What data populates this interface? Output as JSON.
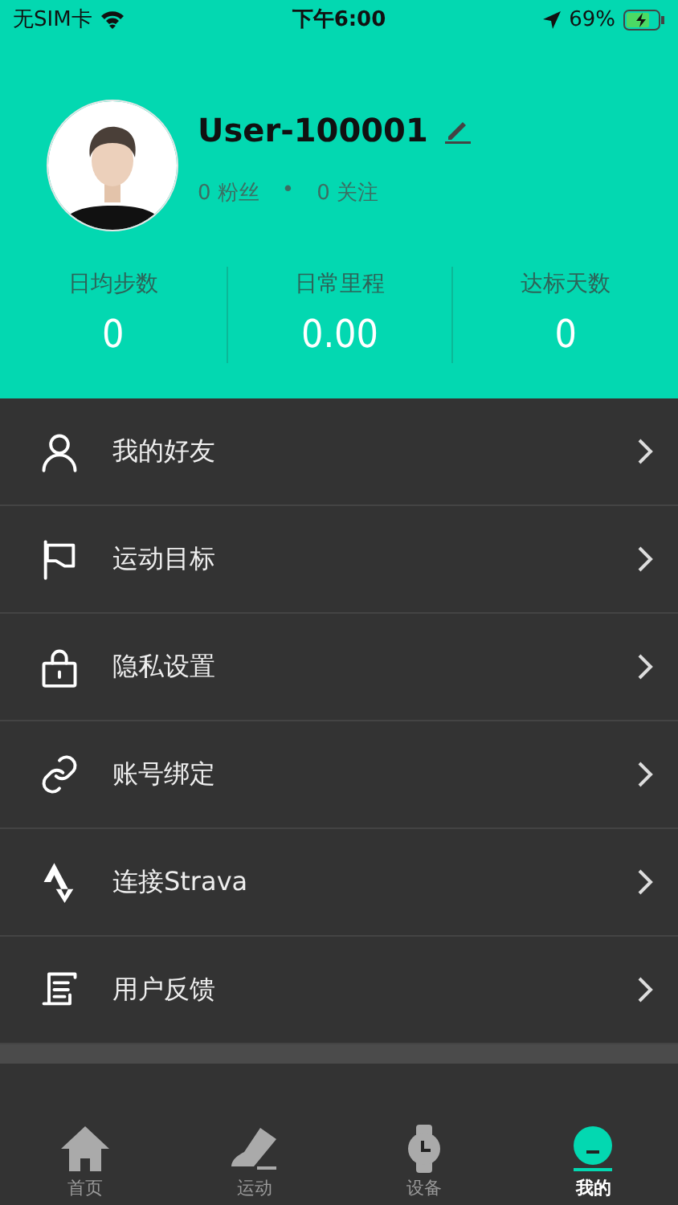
{
  "status_bar": {
    "carrier": "无SIM卡",
    "time": "下午6:00",
    "battery": "69%"
  },
  "profile": {
    "username": "User-100001",
    "followers": "0 粉丝",
    "separator": "•",
    "following": "0 关注"
  },
  "stats": [
    {
      "label": "日均步数",
      "value": "0"
    },
    {
      "label": "日常里程",
      "value": "0.00"
    },
    {
      "label": "达标天数",
      "value": "0"
    }
  ],
  "menu": [
    {
      "kind": "friends",
      "label": "我的好友"
    },
    {
      "kind": "goal",
      "label": "运动目标"
    },
    {
      "kind": "privacy",
      "label": "隐私设置"
    },
    {
      "kind": "binding",
      "label": "账号绑定"
    },
    {
      "kind": "strava",
      "label": "连接Strava"
    },
    {
      "kind": "feedback",
      "label": "用户反馈"
    }
  ],
  "tab_bar": [
    {
      "kind": "home",
      "label": "首页",
      "selected": false
    },
    {
      "kind": "sport",
      "label": "运动",
      "selected": false
    },
    {
      "kind": "device",
      "label": "设备",
      "selected": false
    },
    {
      "kind": "me",
      "label": "我的",
      "selected": true
    }
  ]
}
